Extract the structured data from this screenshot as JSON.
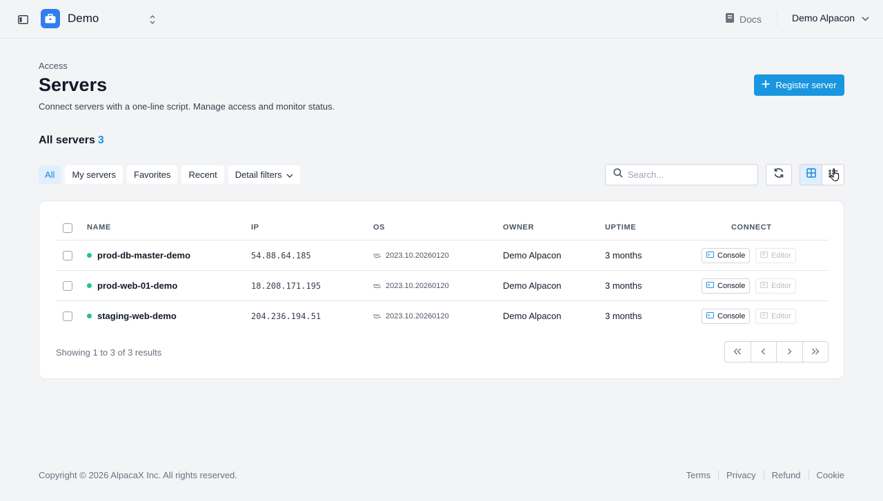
{
  "topbar": {
    "workspace_name": "Demo",
    "docs_label": "Docs",
    "user_name": "Demo Alpacon"
  },
  "header": {
    "breadcrumb": "Access",
    "title": "Servers",
    "subtitle": "Connect servers with a one-line script. Manage access and monitor status.",
    "register_label": "Register server"
  },
  "section": {
    "title": "All servers",
    "count": "3"
  },
  "filters": [
    {
      "label": "All",
      "active": true
    },
    {
      "label": "My servers",
      "active": false
    },
    {
      "label": "Favorites",
      "active": false
    },
    {
      "label": "Recent",
      "active": false
    },
    {
      "label": "Detail filters",
      "active": false
    }
  ],
  "search": {
    "placeholder": "Search..."
  },
  "table": {
    "columns": [
      "NAME",
      "IP",
      "OS",
      "OWNER",
      "UPTIME",
      "CONNECT"
    ],
    "rows": [
      {
        "name": "prod-db-master-demo",
        "ip": "54.88.64.185",
        "os": "2023.10.20260120",
        "owner": "Demo Alpacon",
        "uptime": "3 months",
        "console": "Console",
        "editor": "Editor"
      },
      {
        "name": "prod-web-01-demo",
        "ip": "18.208.171.195",
        "os": "2023.10.20260120",
        "owner": "Demo Alpacon",
        "uptime": "3 months",
        "console": "Console",
        "editor": "Editor"
      },
      {
        "name": "staging-web-demo",
        "ip": "204.236.194.51",
        "os": "2023.10.20260120",
        "owner": "Demo Alpacon",
        "uptime": "3 months",
        "console": "Console",
        "editor": "Editor"
      }
    ]
  },
  "results_text": "Showing 1 to 3 of 3 results",
  "footer": {
    "copyright": "Copyright © 2026 AlpacaX Inc. All rights reserved.",
    "links": [
      "Terms",
      "Privacy",
      "Refund",
      "Cookie"
    ]
  },
  "colors": {
    "accent": "#1a96e0",
    "logo": "#2f7ef0",
    "status_online": "#22c58b",
    "background": "#f3f4f6"
  },
  "icons": {
    "sidebar_toggle": "sidebar-toggle-icon",
    "workspace": "briefcase-icon",
    "docs": "book-icon",
    "search": "search-icon",
    "refresh": "refresh-icon",
    "grid_view": "grid-view-icon",
    "list_view": "list-view-icon",
    "console": "terminal-icon",
    "editor": "editor-icon",
    "os": "aws-icon"
  }
}
